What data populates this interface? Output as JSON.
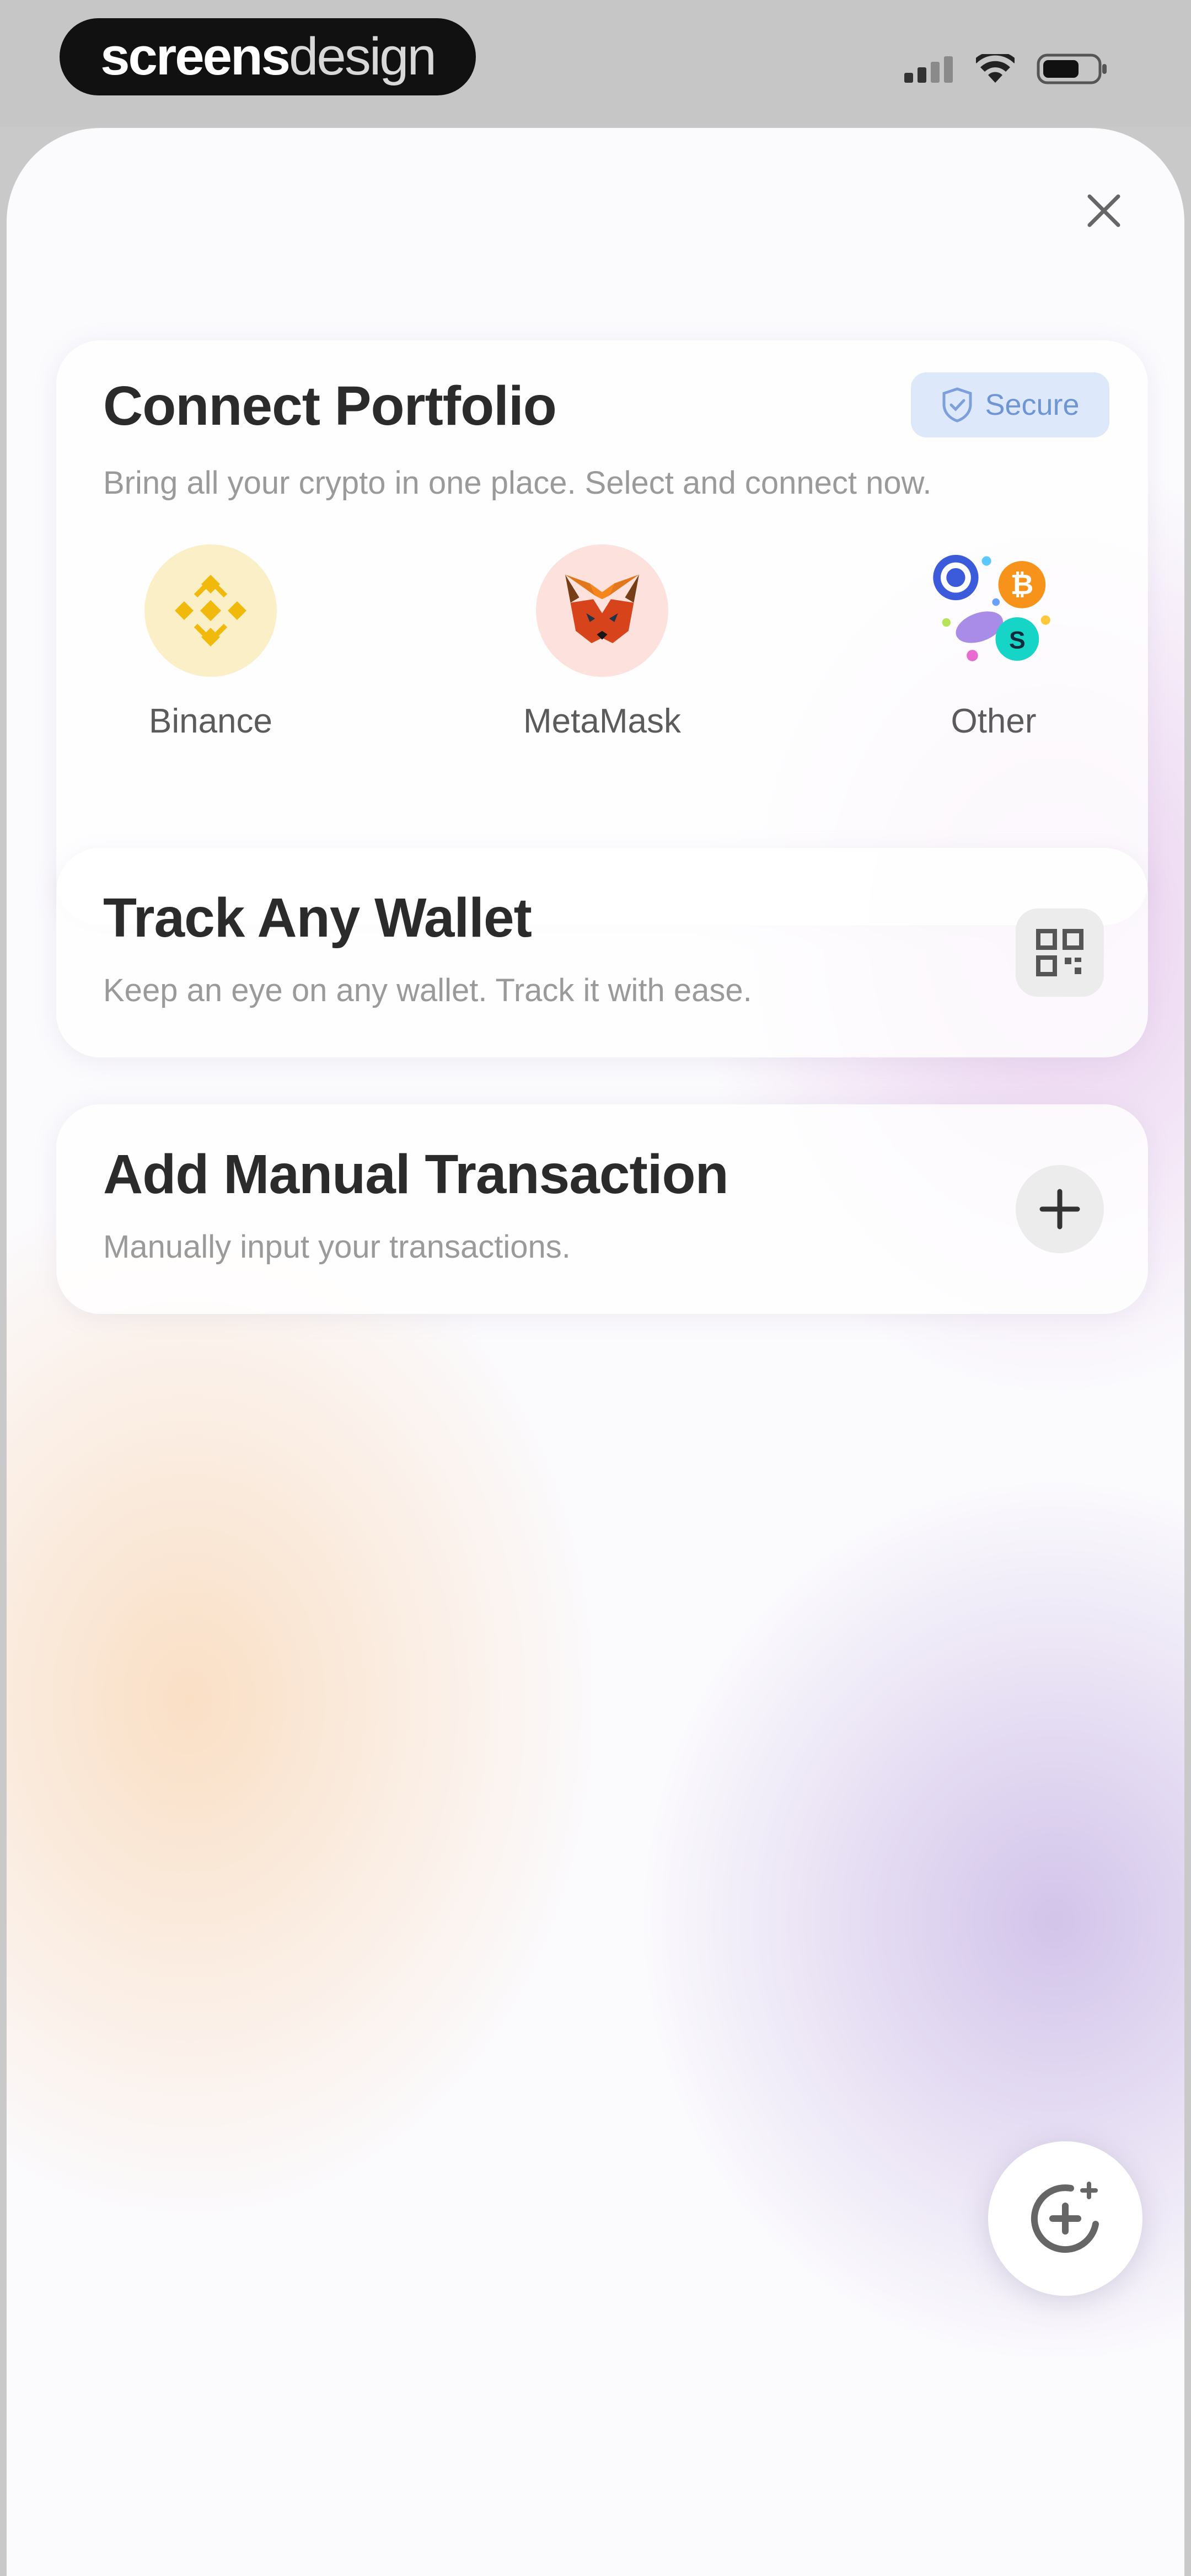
{
  "status_bar": {
    "brand_bold": "screens",
    "brand_light": "design",
    "icons": [
      "signal-icon",
      "wifi-icon",
      "battery-icon"
    ]
  },
  "sheet": {
    "close_icon": "close-icon",
    "connect_portfolio": {
      "title": "Connect Portfolio",
      "subtitle": "Bring all your crypto in one place. Select and connect now.",
      "badge": "Secure",
      "providers": [
        {
          "label": "Binance",
          "icon": "binance-icon",
          "color": "#F3BA2F"
        },
        {
          "label": "MetaMask",
          "icon": "metamask-icon",
          "color": "#E2761B"
        },
        {
          "label": "Other",
          "icon": "other-wallets-icon"
        }
      ]
    },
    "track_wallet": {
      "title": "Track Any Wallet",
      "subtitle": "Keep an eye on any wallet. Track it with ease.",
      "icon": "qr-code-icon"
    },
    "manual_transaction": {
      "title": "Add Manual Transaction",
      "subtitle": "Manually input your transactions.",
      "icon": "plus-icon"
    },
    "fab_icon": "ai-sparkle-icon"
  }
}
